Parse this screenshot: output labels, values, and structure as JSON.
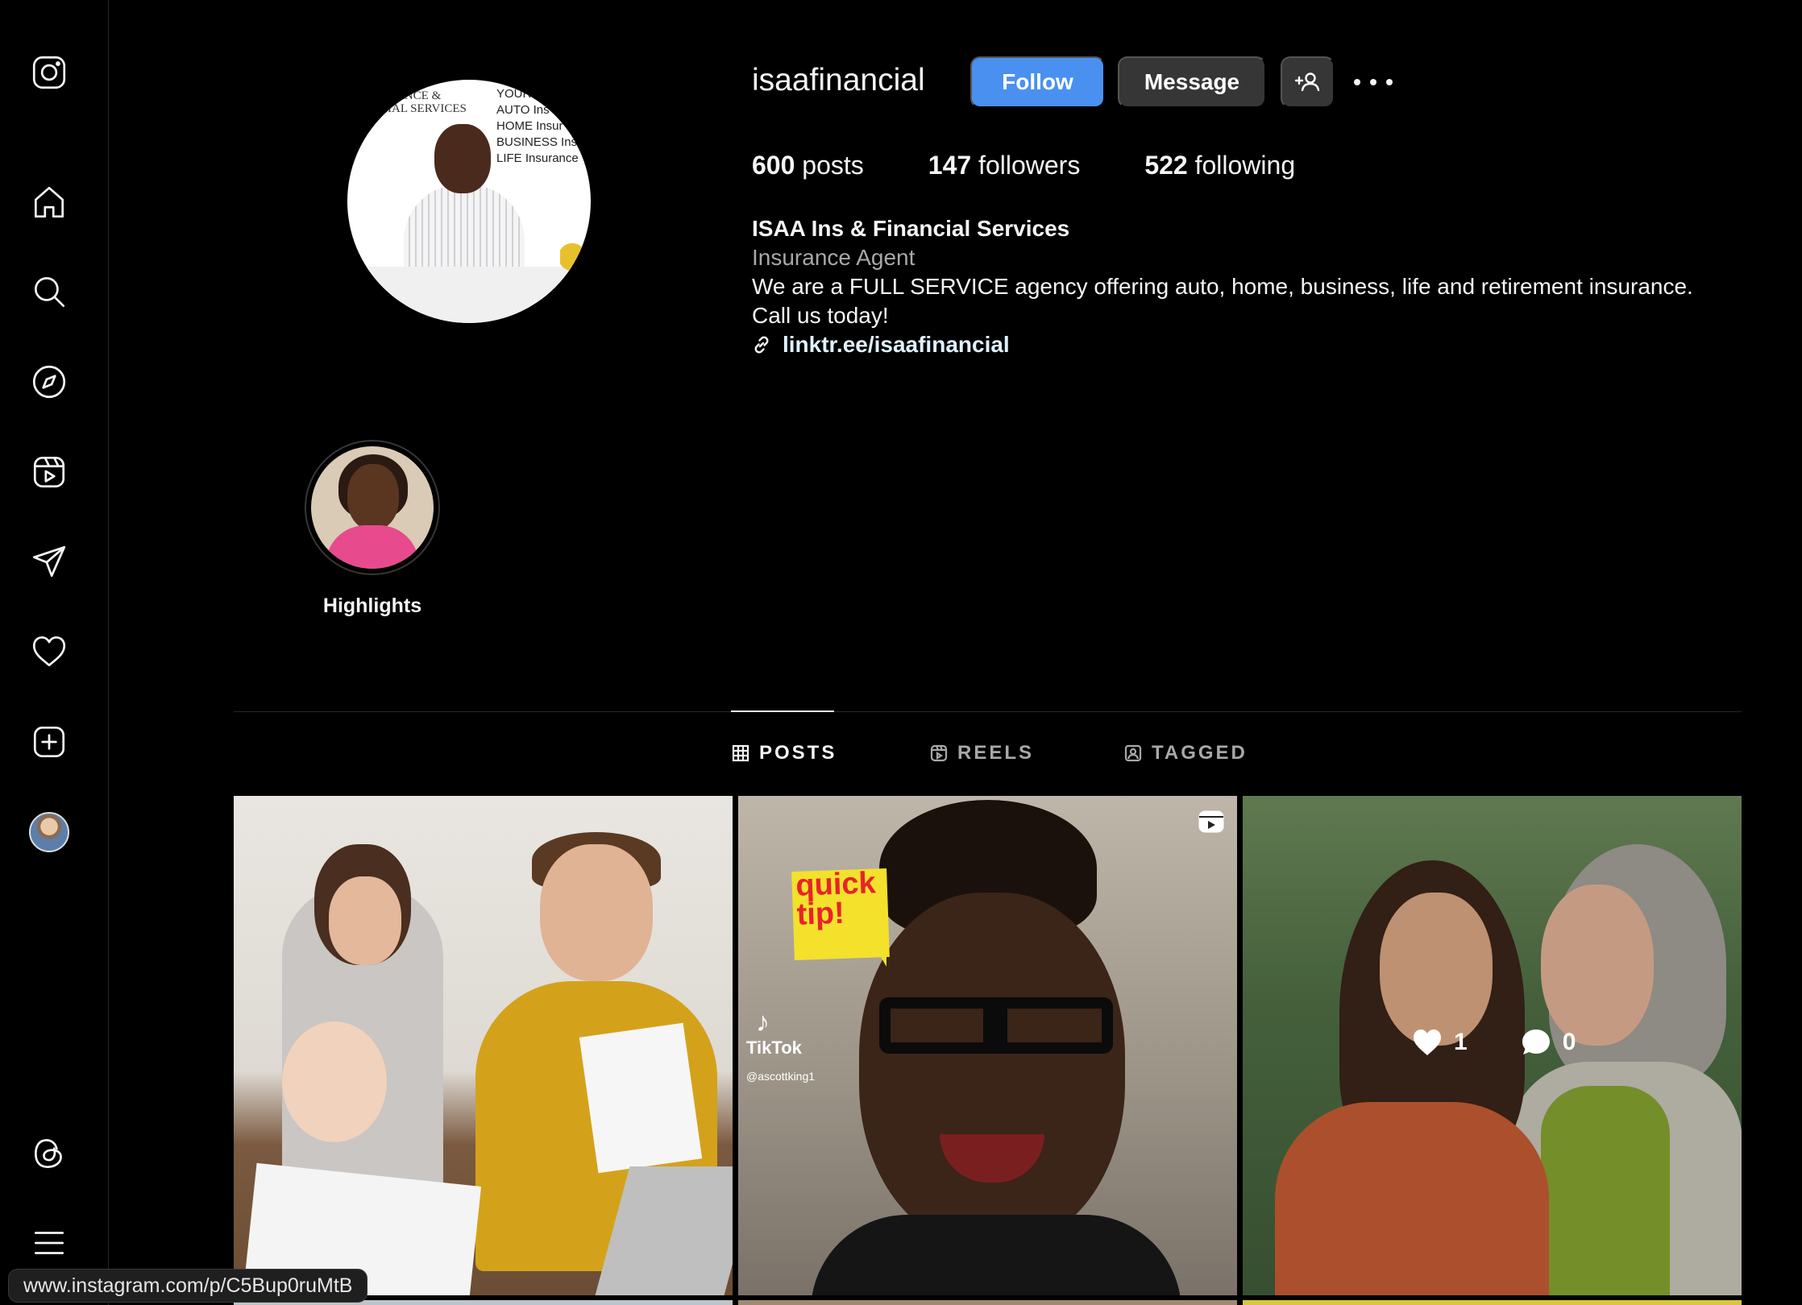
{
  "nav": {
    "items": [
      {
        "name": "instagram-logo-icon"
      },
      {
        "name": "home-icon"
      },
      {
        "name": "search-icon"
      },
      {
        "name": "explore-icon"
      },
      {
        "name": "reels-icon"
      },
      {
        "name": "messages-icon"
      },
      {
        "name": "notifications-icon"
      },
      {
        "name": "create-icon"
      },
      {
        "name": "profile-avatar"
      },
      {
        "name": "threads-icon"
      },
      {
        "name": "more-menu-icon"
      }
    ]
  },
  "profile": {
    "username": "isaafinancial",
    "follow_label": "Follow",
    "message_label": "Message",
    "stats": {
      "posts_count": "600",
      "posts_label": "posts",
      "followers_count": "147",
      "followers_label": "followers",
      "following_count": "522",
      "following_label": "following"
    },
    "full_name": "ISAA Ins & Financial Services",
    "category": "Insurance Agent",
    "bio_line1": "We are a FULL SERVICE agency offering auto, home, business, life and retirement insurance.",
    "bio_line2": "Call us today!",
    "link": "linktr.ee/isaafinancial",
    "avatar_text_left": "RANCE &\nIAL SERVICES",
    "avatar_text_right": "YOUR\nAUTO Ins\nHOME Insur\nBUSINESS Insu\nLIFE Insurance"
  },
  "highlights": [
    {
      "label": "Highlights"
    }
  ],
  "tabs": [
    {
      "label": "POSTS",
      "active": true
    },
    {
      "label": "REELS",
      "active": false
    },
    {
      "label": "TAGGED",
      "active": false
    }
  ],
  "posts": [
    {
      "kind": "photo"
    },
    {
      "kind": "reel",
      "sticker_text": "quick\ntip!",
      "watermark": "TikTok",
      "handle": "@ascottking1"
    },
    {
      "kind": "photo",
      "likes": "1",
      "comments": "0"
    }
  ],
  "status_url": "www.instagram.com/p/C5Bup0ruMtB",
  "colors": {
    "background": "#000000",
    "follow_button": "#4a90f0",
    "secondary_button": "#363636",
    "muted_text": "#a8a8a8"
  }
}
